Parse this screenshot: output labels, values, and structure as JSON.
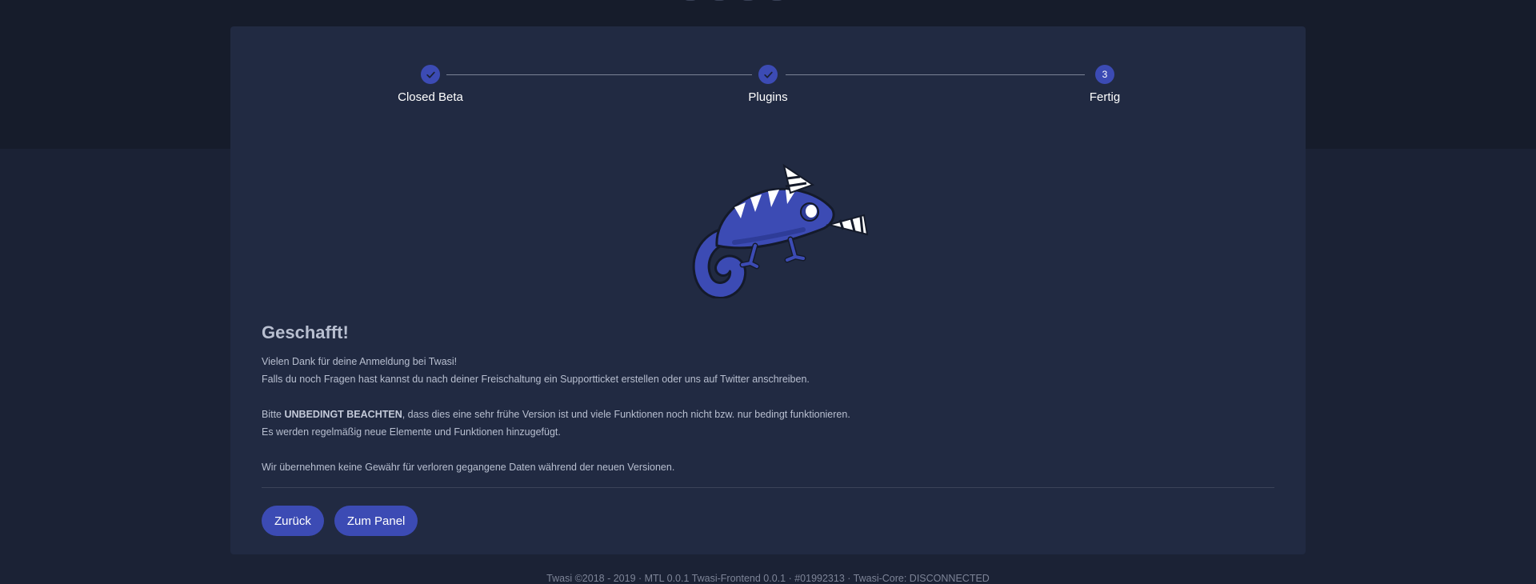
{
  "stepper": {
    "steps": [
      {
        "label": "Closed Beta",
        "state": "done",
        "icon": "check-icon"
      },
      {
        "label": "Plugins",
        "state": "done",
        "icon": "check-icon"
      },
      {
        "label": "Fertig",
        "state": "current",
        "number": "3"
      }
    ]
  },
  "mascot": {
    "icon": "chameleon-party-mascot"
  },
  "main": {
    "title": "Geschafft!",
    "p1_line1": "Vielen Dank für deine Anmeldung bei Twasi!",
    "p1_line2": "Falls du noch Fragen hast kannst du nach deiner Freischaltung ein Supportticket erstellen oder uns auf Twitter anschreiben.",
    "p2_prefix": "Bitte ",
    "p2_bold": "UNBEDINGT BEACHTEN",
    "p2_suffix": ", dass dies eine sehr frühe Version ist und viele Funktionen noch nicht bzw. nur bedingt funktionieren.",
    "p2_line2": "Es werden regelmäßig neue Elemente und Funktionen hinzugefügt.",
    "p3": "Wir übernehmen keine Gewähr für verloren gegangene Daten während der neuen Versionen."
  },
  "actions": {
    "back_label": "Zurück",
    "panel_label": "Zum Panel"
  },
  "footer": {
    "text": "Twasi ©2018 - 2019 · MTL 0.0.1 Twasi-Frontend 0.0.1 · #01992313 · Twasi-Core: DISCONNECTED"
  },
  "colors": {
    "accent": "#3c4bb4",
    "card": "#212a42",
    "background": "#1b2235"
  }
}
